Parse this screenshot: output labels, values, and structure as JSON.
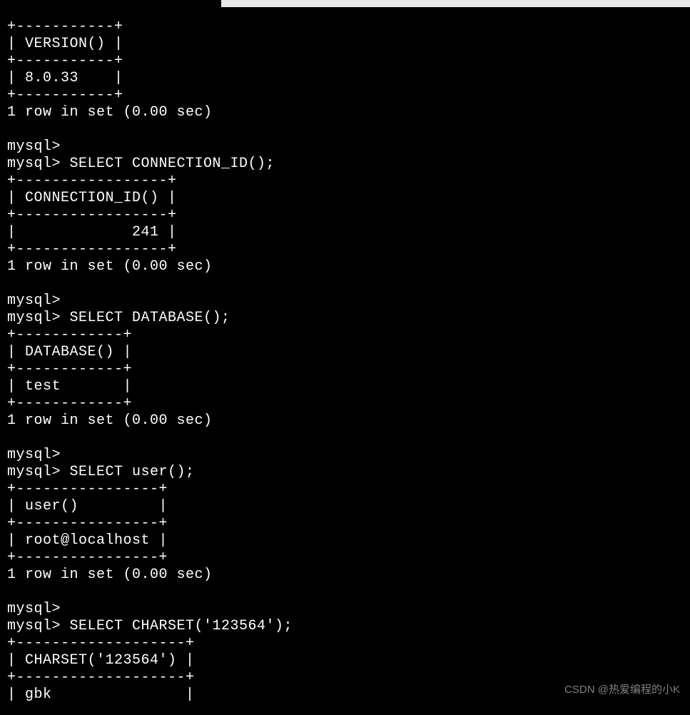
{
  "terminal": {
    "lines": [
      "+-----------+",
      "| VERSION() |",
      "+-----------+",
      "| 8.0.33    |",
      "+-----------+",
      "1 row in set (0.00 sec)",
      "",
      "mysql>",
      "mysql> SELECT CONNECTION_ID();",
      "+-----------------+",
      "| CONNECTION_ID() |",
      "+-----------------+",
      "|             241 |",
      "+-----------------+",
      "1 row in set (0.00 sec)",
      "",
      "mysql>",
      "mysql> SELECT DATABASE();",
      "+------------+",
      "| DATABASE() |",
      "+------------+",
      "| test       |",
      "+------------+",
      "1 row in set (0.00 sec)",
      "",
      "mysql>",
      "mysql> SELECT user();",
      "+----------------+",
      "| user()         |",
      "+----------------+",
      "| root@localhost |",
      "+----------------+",
      "1 row in set (0.00 sec)",
      "",
      "mysql>",
      "mysql> SELECT CHARSET('123564');",
      "+-------------------+",
      "| CHARSET('123564') |",
      "+-------------------+",
      "| gbk               |"
    ]
  },
  "watermark": {
    "text": "CSDN @热爱编程的小K"
  }
}
